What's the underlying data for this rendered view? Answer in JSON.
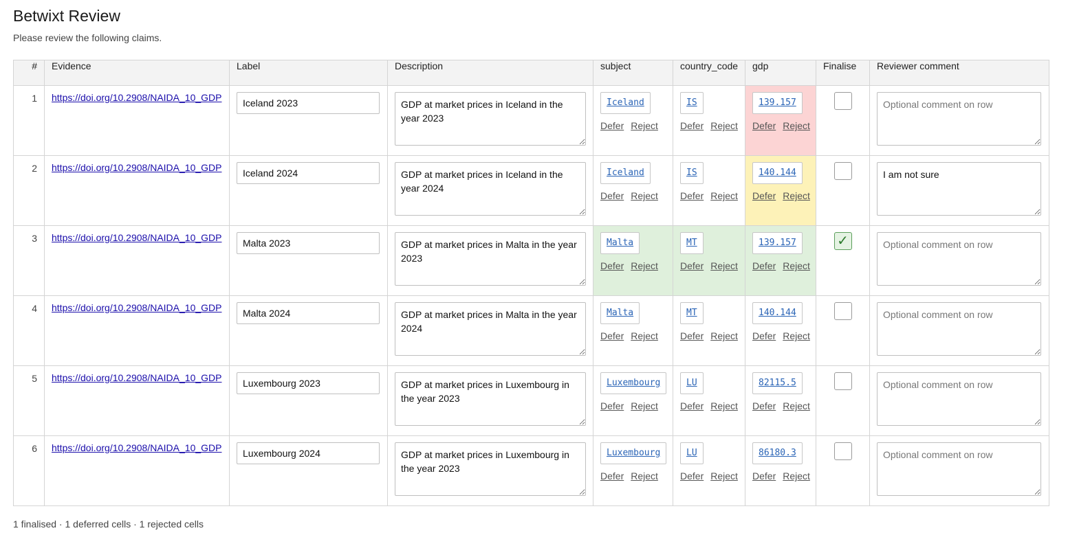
{
  "page": {
    "title": "Betwixt Review",
    "subtitle": "Please review the following claims.",
    "summary": "1 finalised · 1 deferred cells · 1 rejected cells"
  },
  "table": {
    "headers": [
      "#",
      "Evidence",
      "Label",
      "Description",
      "subject",
      "country_code",
      "gdp",
      "Finalise",
      "Reviewer comment"
    ],
    "defer_label": "Defer",
    "reject_label": "Reject",
    "comment_placeholder": "Optional comment on row",
    "check_glyph": "✓",
    "state_colors": {
      "rejected": "#fcd4d4",
      "deferred": "#fdf2b8",
      "finalised": "#dff0dc"
    },
    "rows": [
      {
        "num": "1",
        "evidence": "https://doi.org/10.2908/NAIDA_10_GDP",
        "label": "Iceland 2023",
        "description": "GDP at market prices in Iceland in the year 2023",
        "subject": "Iceland",
        "country_code": "IS",
        "gdp": "139.157",
        "subject_state": "",
        "country_code_state": "",
        "gdp_state": "rejected",
        "finalised": false,
        "comment": ""
      },
      {
        "num": "2",
        "evidence": "https://doi.org/10.2908/NAIDA_10_GDP",
        "label": "Iceland 2024",
        "description": "GDP at market prices in Iceland in the year 2024",
        "subject": "Iceland",
        "country_code": "IS",
        "gdp": "140.144",
        "subject_state": "",
        "country_code_state": "",
        "gdp_state": "deferred",
        "finalised": false,
        "comment": "I am not sure"
      },
      {
        "num": "3",
        "evidence": "https://doi.org/10.2908/NAIDA_10_GDP",
        "label": "Malta 2023",
        "description": "GDP at market prices in Malta in the year 2023",
        "subject": "Malta",
        "country_code": "MT",
        "gdp": "139.157",
        "subject_state": "finalised",
        "country_code_state": "finalised",
        "gdp_state": "finalised",
        "finalised": true,
        "comment": ""
      },
      {
        "num": "4",
        "evidence": "https://doi.org/10.2908/NAIDA_10_GDP",
        "label": "Malta 2024",
        "description": "GDP at market prices in Malta in the year 2024",
        "subject": "Malta",
        "country_code": "MT",
        "gdp": "140.144",
        "subject_state": "",
        "country_code_state": "",
        "gdp_state": "",
        "finalised": false,
        "comment": ""
      },
      {
        "num": "5",
        "evidence": "https://doi.org/10.2908/NAIDA_10_GDP",
        "label": "Luxembourg 2023",
        "description": "GDP at market prices in Luxembourg in the year 2023",
        "subject": "Luxembourg",
        "country_code": "LU",
        "gdp": "82115.5",
        "subject_state": "",
        "country_code_state": "",
        "gdp_state": "",
        "finalised": false,
        "comment": ""
      },
      {
        "num": "6",
        "evidence": "https://doi.org/10.2908/NAIDA_10_GDP",
        "label": "Luxembourg 2024",
        "description": "GDP at market prices in Luxembourg in the year 2023",
        "subject": "Luxembourg",
        "country_code": "LU",
        "gdp": "86180.3",
        "subject_state": "",
        "country_code_state": "",
        "gdp_state": "",
        "finalised": false,
        "comment": ""
      }
    ]
  }
}
